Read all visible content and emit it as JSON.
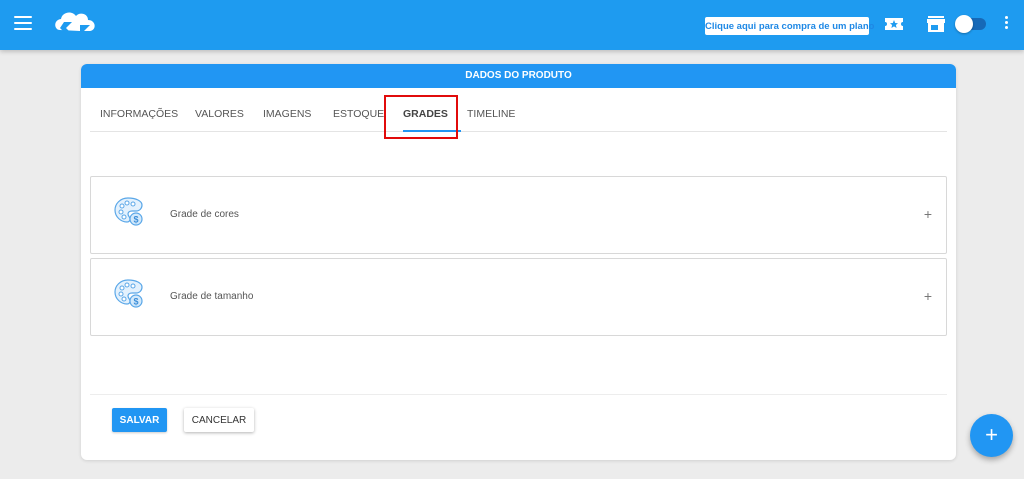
{
  "header": {
    "plan_button_label": "Clique aqui para compra de um plano",
    "icons": [
      "menu-icon",
      "logo-icon",
      "ticket-icon",
      "store-icon",
      "toggle-switch",
      "more-vert-icon"
    ]
  },
  "card": {
    "title": "DADOS DO PRODUTO",
    "tabs": [
      {
        "label": "INFORMAÇÕES",
        "active": false
      },
      {
        "label": "VALORES",
        "active": false
      },
      {
        "label": "IMAGENS",
        "active": false
      },
      {
        "label": "ESTOQUE",
        "active": false
      },
      {
        "label": "GRADES",
        "active": true
      },
      {
        "label": "TIMELINE",
        "active": false
      }
    ],
    "panels": [
      {
        "label": "Grade de cores",
        "icon": "palette-dollar-icon",
        "expand_symbol": "+"
      },
      {
        "label": "Grade de tamanho",
        "icon": "palette-dollar-icon",
        "expand_symbol": "+"
      }
    ],
    "save_label": "SALVAR",
    "cancel_label": "CANCELAR"
  },
  "fab": {
    "symbol": "+"
  },
  "colors": {
    "primary": "#2196f3",
    "topbar": "#1e9bf0",
    "highlight": "#e10b0b"
  }
}
